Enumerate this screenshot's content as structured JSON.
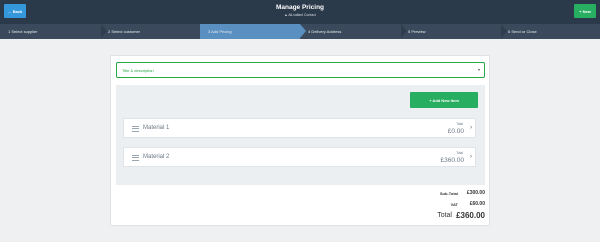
{
  "header": {
    "back_label": "← Back",
    "new_label": "+ New",
    "title": "Manage Pricing",
    "subtitle": "▲ Ali-vallant Contact"
  },
  "steps": [
    {
      "label": "1 Select supplier",
      "active": false
    },
    {
      "label": "2 Select customer",
      "active": false
    },
    {
      "label": "3 Add Pricing",
      "active": true
    },
    {
      "label": "4 Delivery Address",
      "active": false
    },
    {
      "label": "5 Preview",
      "active": false
    },
    {
      "label": "6 Send or Close",
      "active": false
    }
  ],
  "form": {
    "title_select_label": "Title & description",
    "add_item_label": "+ Add New Item"
  },
  "items": [
    {
      "name": "Material 1",
      "total_label": "Total",
      "amount": "£0.00"
    },
    {
      "name": "Material 2",
      "total_label": "Total",
      "amount": "£360.00"
    }
  ],
  "summary": {
    "subtotal_label": "Sub-Total",
    "subtotal_value": "£300.00",
    "vat_label": "VAT",
    "vat_value": "£60.00",
    "total_label": "Total",
    "total_value": "£360.00"
  },
  "colors": {
    "header_bg": "#2b3a4a",
    "active_step": "#5a8fc1",
    "accent_green": "#27ae60",
    "back_blue": "#3498db"
  }
}
